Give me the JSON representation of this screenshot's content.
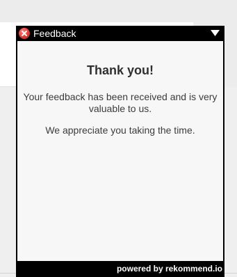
{
  "widget": {
    "title": "Feedback",
    "heading": "Thank you!",
    "message": "Your feedback has been received and is very valuable to us.",
    "message_secondary": "We appreciate you taking the time.",
    "powered_by": "powered by rekommend.io",
    "icons": {
      "close": "close-icon",
      "collapse": "chevron-down-icon"
    }
  },
  "colors": {
    "header_bg": "#000000",
    "content_bg": "#f7f7f7",
    "close_red": "#e23b35"
  }
}
